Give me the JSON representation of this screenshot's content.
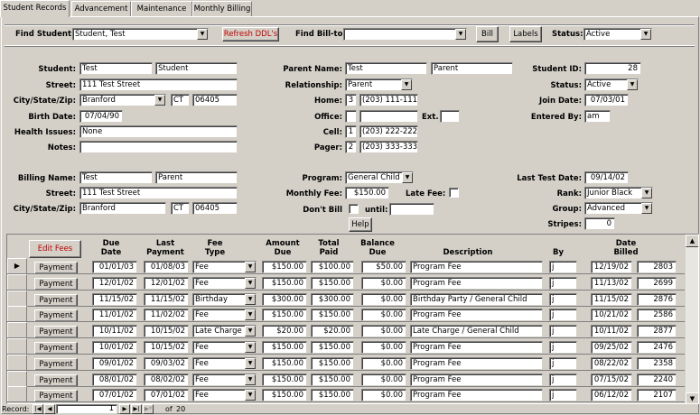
{
  "tabs": [
    "Student Records",
    "Advancement",
    "Maintenance",
    "Monthly Billing"
  ],
  "toolbar": {
    "find_student_label": "Find Student:",
    "find_student_value": "Student, Test",
    "refresh_label": "Refresh DDL's",
    "find_billto_label": "Find Bill-to:",
    "find_billto_value": "",
    "bill_label": "Bill",
    "labels_label": "Labels",
    "status_label": "Status:",
    "status_value": "Active"
  },
  "student": {
    "student_label": "Student:",
    "first": "Test",
    "last": "Student",
    "street_label": "Street:",
    "street": "111 Test Street",
    "csz_label": "City/State/Zip:",
    "city": "Branford",
    "state": "CT",
    "zip": "06405",
    "birth_label": "Birth Date:",
    "birth": "07/04/90",
    "health_label": "Health Issues:",
    "health": "None",
    "notes_label": "Notes:",
    "notes": ""
  },
  "parent": {
    "name_label": "Parent Name:",
    "first": "Test",
    "last": "Parent",
    "rel_label": "Relationship:",
    "rel": "Parent",
    "home_label": "Home:",
    "home_n": "3",
    "home": "(203) 111-1111",
    "office_label": "Office:",
    "office_n": "",
    "office": "",
    "ext_label": "Ext.",
    "ext": "",
    "cell_label": "Cell:",
    "cell_n": "1",
    "cell": "(203) 222-2222",
    "pager_label": "Pager:",
    "pager_n": "2",
    "pager": "(203) 333-3333"
  },
  "info": {
    "id_label": "Student ID:",
    "id": "28",
    "status_label": "Status:",
    "status": "Active",
    "join_label": "Join Date:",
    "join": "07/03/01",
    "entered_label": "Entered By:",
    "entered": "am"
  },
  "billing": {
    "name_label": "Billing Name:",
    "first": "Test",
    "last": "Parent",
    "street_label": "Street:",
    "street": "111 Test Street",
    "csz_label": "City/State/Zip:",
    "city": "Branford",
    "state": "CT",
    "zip": "06405"
  },
  "program": {
    "program_label": "Program:",
    "program": "General Child",
    "fee_label": "Monthly Fee:",
    "fee": "$150.00",
    "late_label": "Late Fee:",
    "dontbill_label": "Don't Bill",
    "until_label": "until:",
    "until": "",
    "help_label": "Help"
  },
  "rank": {
    "last_test_label": "Last Test Date:",
    "last_test": "09/14/02",
    "rank_label": "Rank:",
    "rank": "Junior Black",
    "group_label": "Group:",
    "group": "Advanced",
    "stripes_label": "Stripes:",
    "stripes": "0"
  },
  "fees": {
    "edit_label": "Edit Fees",
    "headers": {
      "due_date": "Due\nDate",
      "last_payment": "Last\nPayment",
      "fee_type": "Fee\nType",
      "amount_due": "Amount\nDue",
      "total_paid": "Total\nPaid",
      "balance_due": "Balance\nDue",
      "description": "Description",
      "by": "By",
      "date_billed": "Date\nBilled"
    },
    "payment_label": "Payment",
    "rows": [
      {
        "due": "01/01/03",
        "last": "01/08/03",
        "type": "Fee",
        "amount": "$150.00",
        "paid": "$100.00",
        "balance": "$50.00",
        "desc": "Program Fee",
        "by": "j",
        "billed": "12/19/02",
        "id": "2803"
      },
      {
        "due": "12/01/02",
        "last": "12/01/02",
        "type": "Fee",
        "amount": "$150.00",
        "paid": "$150.00",
        "balance": "$0.00",
        "desc": "Program Fee",
        "by": "j",
        "billed": "11/13/02",
        "id": "2699"
      },
      {
        "due": "11/15/02",
        "last": "11/15/02",
        "type": "Birthday",
        "amount": "$300.00",
        "paid": "$300.00",
        "balance": "$0.00",
        "desc": "Birthday Party / General Child",
        "by": "j",
        "billed": "11/15/02",
        "id": "2876"
      },
      {
        "due": "11/01/02",
        "last": "11/02/02",
        "type": "Fee",
        "amount": "$150.00",
        "paid": "$150.00",
        "balance": "$0.00",
        "desc": "Program Fee",
        "by": "j",
        "billed": "10/21/02",
        "id": "2586"
      },
      {
        "due": "10/11/02",
        "last": "10/15/02",
        "type": "Late Charge",
        "amount": "$20.00",
        "paid": "$20.00",
        "balance": "$0.00",
        "desc": "Late Charge / General Child",
        "by": "j",
        "billed": "10/11/02",
        "id": "2877"
      },
      {
        "due": "10/01/02",
        "last": "10/15/02",
        "type": "Fee",
        "amount": "$150.00",
        "paid": "$150.00",
        "balance": "$0.00",
        "desc": "Program Fee",
        "by": "j",
        "billed": "09/25/02",
        "id": "2476"
      },
      {
        "due": "09/01/02",
        "last": "09/03/02",
        "type": "Fee",
        "amount": "$150.00",
        "paid": "$150.00",
        "balance": "$0.00",
        "desc": "Program Fee",
        "by": "j",
        "billed": "08/22/02",
        "id": "2358"
      },
      {
        "due": "08/01/02",
        "last": "08/02/02",
        "type": "Fee",
        "amount": "$150.00",
        "paid": "$150.00",
        "balance": "$0.00",
        "desc": "Program Fee",
        "by": "j",
        "billed": "07/15/02",
        "id": "2240"
      },
      {
        "due": "07/01/02",
        "last": "07/01/02",
        "type": "Fee",
        "amount": "$150.00",
        "paid": "$150.00",
        "balance": "$0.00",
        "desc": "Program Fee",
        "by": "j",
        "billed": "06/12/02",
        "id": "2107"
      }
    ]
  },
  "navigation": {
    "record_label": "Record:",
    "current": "1",
    "of_label": "of",
    "total": "20"
  }
}
